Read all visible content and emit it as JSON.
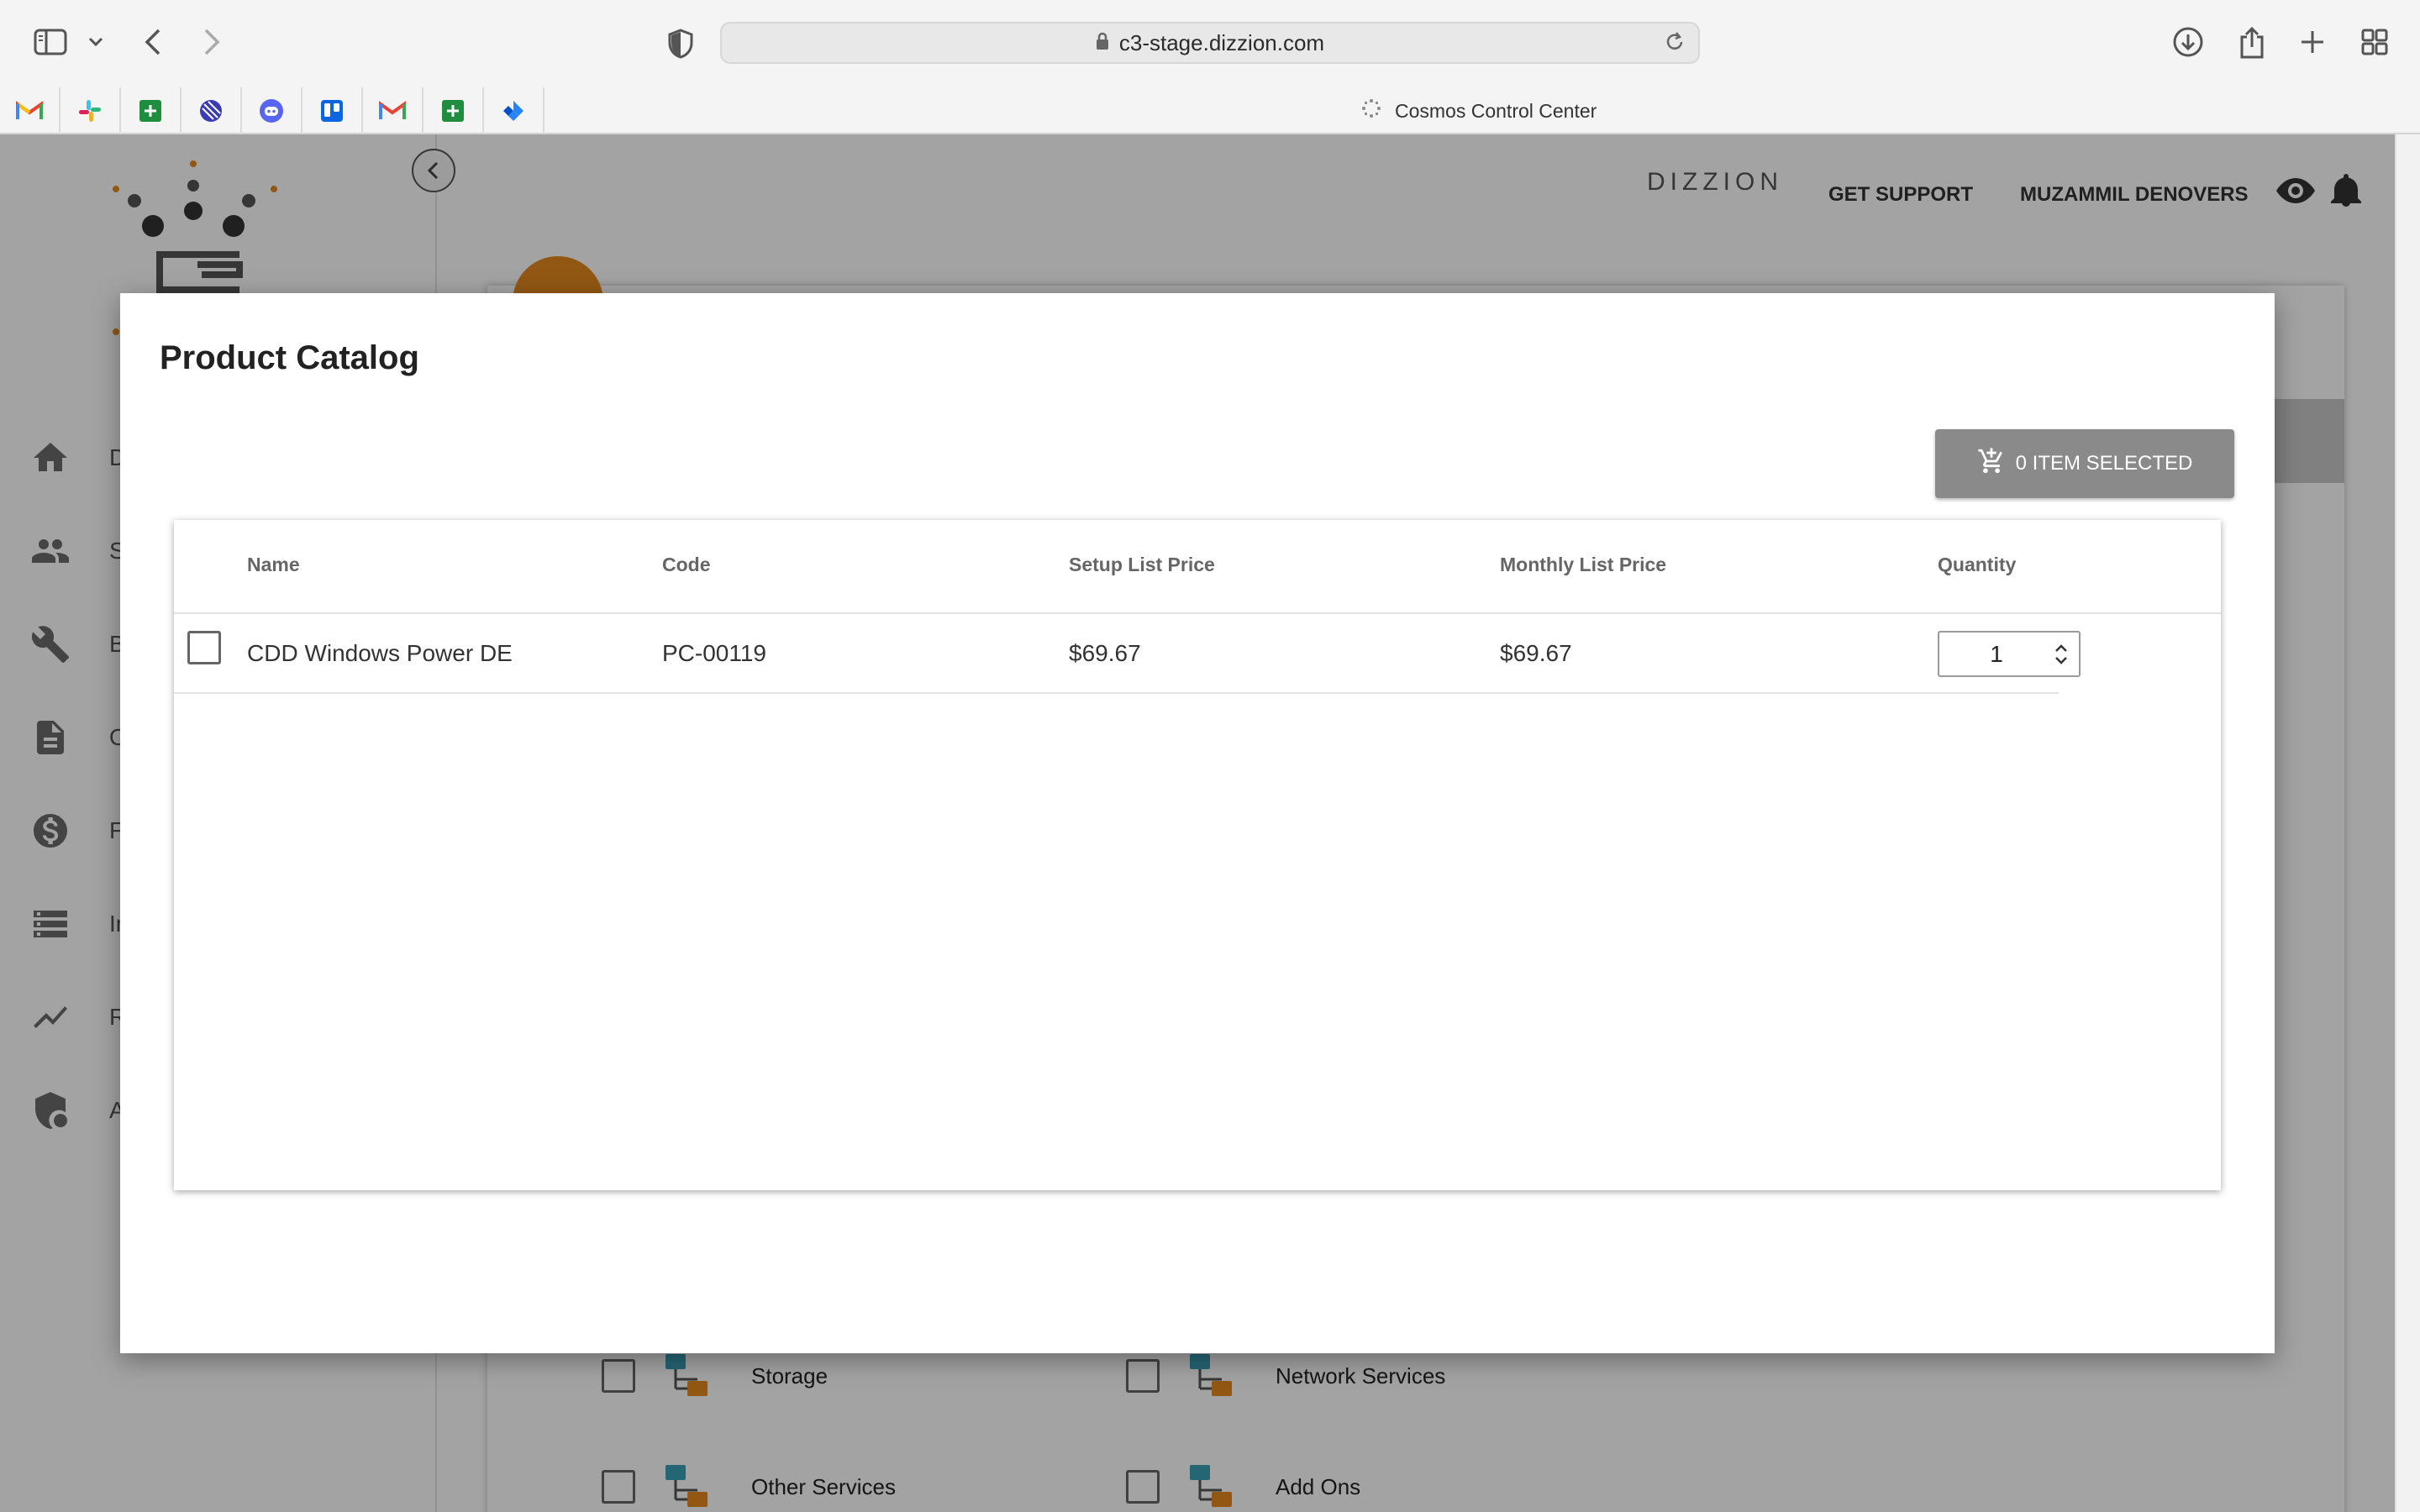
{
  "browser": {
    "url": "c3-stage.dizzion.com",
    "tab_title": "Cosmos Control Center",
    "bookmarks": [
      "gmail-icon",
      "slack-icon",
      "sheets-icon",
      "linear-icon",
      "discord-icon",
      "trello-icon",
      "gmail-icon",
      "sheets-icon",
      "jira-icon"
    ]
  },
  "header": {
    "brand": "DIZZION",
    "support_label": "GET SUPPORT",
    "user_name": "MUZAMMIL DENOVERS"
  },
  "sidebar": {
    "items": [
      {
        "label": "Da",
        "icon": "home-icon"
      },
      {
        "label": "Su",
        "icon": "people-icon"
      },
      {
        "label": "Bu",
        "icon": "wrench-icon"
      },
      {
        "label": "Or",
        "icon": "document-icon"
      },
      {
        "label": "Fi",
        "icon": "dollar-icon"
      },
      {
        "label": "In",
        "icon": "server-icon"
      },
      {
        "label": "Re",
        "icon": "trend-icon"
      },
      {
        "label": "Ac",
        "icon": "shield-icon"
      }
    ]
  },
  "services": [
    {
      "label": "Storage"
    },
    {
      "label": "Network Services"
    },
    {
      "label": "Other Services"
    },
    {
      "label": "Add Ons"
    }
  ],
  "modal": {
    "title": "Product Catalog",
    "cart_button": "0 ITEM SELECTED",
    "columns": [
      "Name",
      "Code",
      "Setup List Price",
      "Monthly List Price",
      "Quantity"
    ],
    "rows": [
      {
        "name": "CDD Windows Power DE",
        "code": "PC-00119",
        "setup_price": "$69.67",
        "monthly_price": "$69.67",
        "quantity": "1"
      }
    ]
  },
  "colors": {
    "accent_orange": "#e58a1f",
    "cart_button_bg": "#8a8a8a",
    "overlay": "rgba(0,0,0,0.36)"
  }
}
